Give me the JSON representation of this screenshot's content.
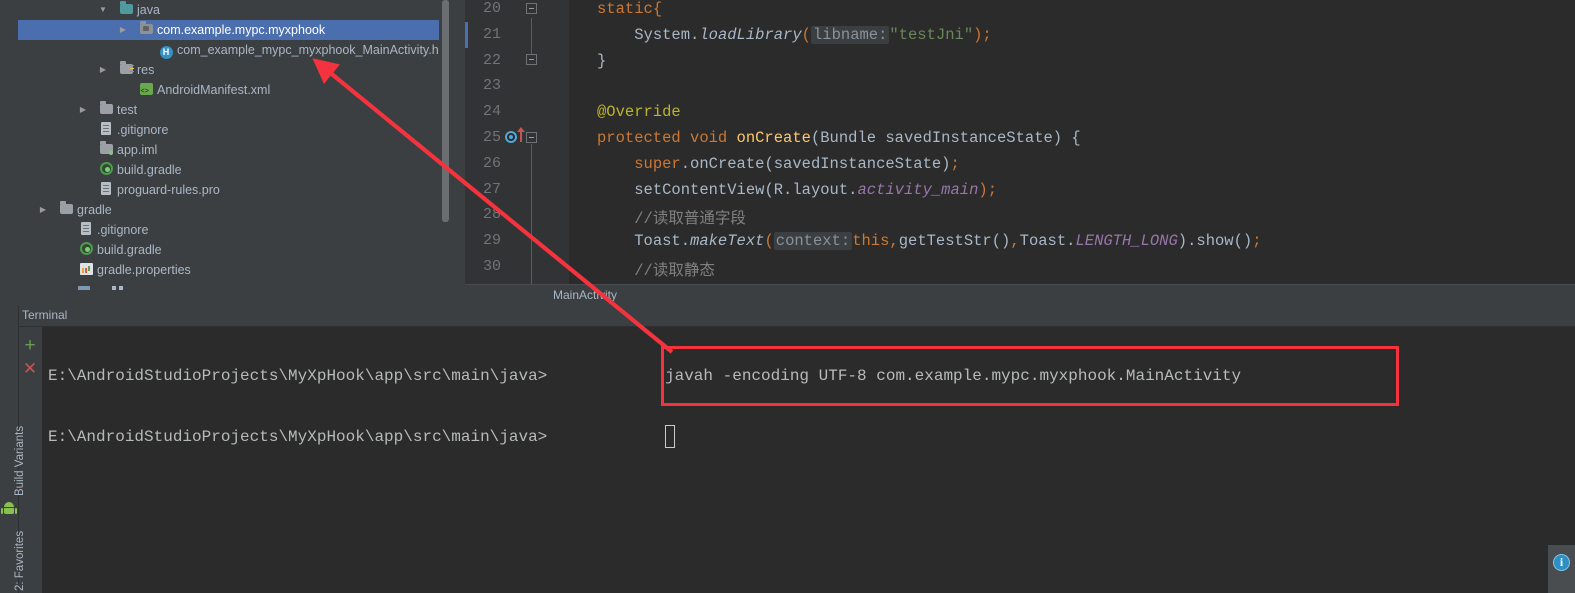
{
  "app": {
    "theme_bg": "#3c3f41",
    "editor_bg": "#2b2b2b",
    "accent_selection": "#4b6eaf",
    "annotation_color": "#f5333f"
  },
  "project_tree": {
    "items": [
      {
        "label": "java",
        "indent": 100,
        "twisty": "▼",
        "icon": "folder-teal-icon",
        "selected": false
      },
      {
        "label": "com.example.mypc.myxphook",
        "indent": 120,
        "twisty": "▶",
        "icon": "package-folder-icon",
        "selected": true
      },
      {
        "label": "com_example_mypc_myxphook_MainActivity.h",
        "indent": 140,
        "twisty": "",
        "icon": "h-header-file-icon",
        "selected": false
      },
      {
        "label": "res",
        "indent": 100,
        "twisty": "▶",
        "icon": "res-folder-icon",
        "selected": false
      },
      {
        "label": "AndroidManifest.xml",
        "indent": 120,
        "twisty": "",
        "icon": "android-manifest-icon",
        "selected": false
      },
      {
        "label": "test",
        "indent": 80,
        "twisty": "▶",
        "icon": "folder-gray-icon",
        "selected": false
      },
      {
        "label": ".gitignore",
        "indent": 80,
        "twisty": "",
        "icon": "text-file-icon",
        "selected": false
      },
      {
        "label": "app.iml",
        "indent": 80,
        "twisty": "",
        "icon": "iml-module-icon",
        "selected": false
      },
      {
        "label": "build.gradle",
        "indent": 80,
        "twisty": "",
        "icon": "gradle-file-icon",
        "selected": false
      },
      {
        "label": "proguard-rules.pro",
        "indent": 80,
        "twisty": "",
        "icon": "text-file-icon",
        "selected": false
      },
      {
        "label": "gradle",
        "indent": 40,
        "twisty": "▶",
        "icon": "folder-gray-icon",
        "selected": false
      },
      {
        "label": ".gitignore",
        "indent": 60,
        "twisty": "",
        "icon": "text-file-icon",
        "selected": false
      },
      {
        "label": "build.gradle",
        "indent": 60,
        "twisty": "",
        "icon": "gradle-file-icon",
        "selected": false
      },
      {
        "label": "gradle.properties",
        "indent": 60,
        "twisty": "",
        "icon": "properties-file-icon",
        "selected": false
      }
    ]
  },
  "editor": {
    "lines": [
      {
        "num": "20",
        "text": "static{",
        "has_fold": true
      },
      {
        "num": "21",
        "text": "    System.loadLibrary( libname: \"testJni\");",
        "has_fold": false
      },
      {
        "num": "22",
        "text": "}",
        "has_fold": true
      },
      {
        "num": "23",
        "text": "",
        "has_fold": false
      },
      {
        "num": "24",
        "text": "@Override",
        "has_fold": false
      },
      {
        "num": "25",
        "text": "protected void onCreate(Bundle savedInstanceState) {",
        "has_fold": true
      },
      {
        "num": "26",
        "text": "    super.onCreate(savedInstanceState);",
        "has_fold": false
      },
      {
        "num": "27",
        "text": "    setContentView(R.layout.activity_main);",
        "has_fold": false
      },
      {
        "num": "28",
        "text": "    //读取普通字段",
        "has_fold": false
      },
      {
        "num": "29",
        "text": "    Toast.makeText( context: this,getTestStr(),Toast.LENGTH_LONG).show();",
        "has_fold": false
      },
      {
        "num": "30",
        "text": "    //读取静态",
        "has_fold": false
      }
    ],
    "tokens": {
      "kw_static": "static",
      "brace_open": "{",
      "system": "System.",
      "load_library": "loadLibrary",
      "paren_open": "(",
      "hint_libname": "libname:",
      "str_testjni": "\"testJni\"",
      "close_paren_semi": ");",
      "brace_close": "}",
      "annotation_override": "@Override",
      "kw_protected": "protected",
      "kw_void": "void",
      "mth_oncreate": "onCreate",
      "oncreate_args": "(Bundle savedInstanceState) {",
      "kw_super": "super",
      "super_call": ".onCreate(savedInstanceState)",
      "semi": ";",
      "setcontentview": "setContentView(R.layout.",
      "activity_main": "activity_main",
      "comment_1": "//读取普通字段",
      "toast": "Toast.",
      "maketext": "makeText",
      "hint_context": "context:",
      "kw_this": "this",
      "gettest": ",getTestStr(),Toast.",
      "length_long": "LENGTH_LONG",
      "show": ").show();",
      "comment_2": "//读取静态"
    }
  },
  "breadcrumb": {
    "text": "MainActivity"
  },
  "terminal": {
    "title": "Terminal",
    "add_tab_glyph": "+",
    "close_tab_glyph": "✕",
    "prompt_1": "E:\\AndroidStudioProjects\\MyXpHook\\app\\src\\main\\java>",
    "command_1": "javah -encoding UTF-8 com.example.mypc.myxphook.MainActivity",
    "prompt_2": "E:\\AndroidStudioProjects\\MyXpHook\\app\\src\\main\\java>"
  },
  "left_toolbar": {
    "build_variants_label": "Build Variants",
    "favorites_label": "2: Favorites"
  },
  "status_bar": {
    "info_glyph": "i"
  }
}
